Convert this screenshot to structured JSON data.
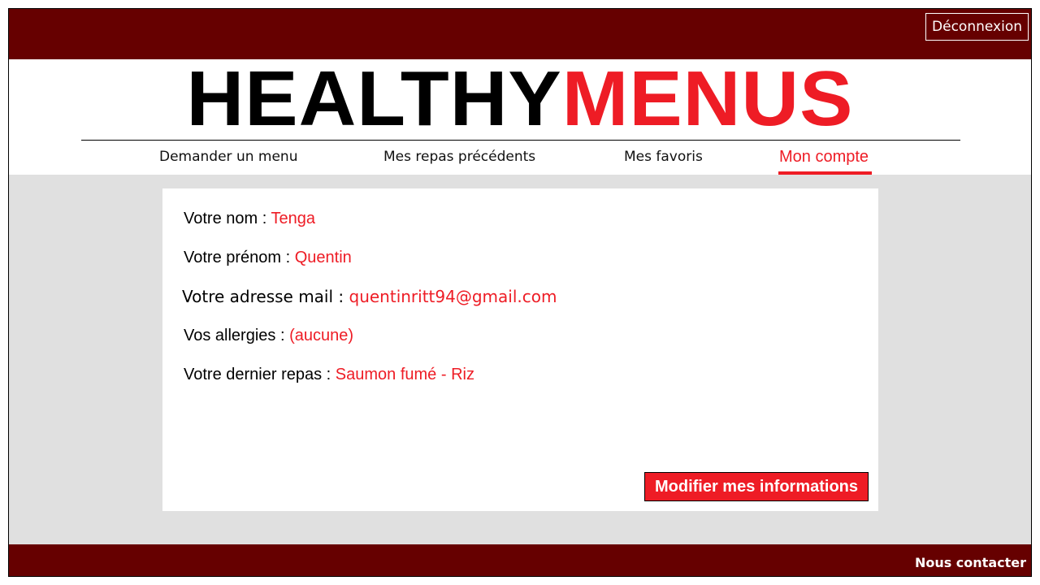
{
  "header": {
    "logout_label": "Déconnexion",
    "logo_part1": "HEALTHY",
    "logo_part2": "MENUS"
  },
  "nav": {
    "items": [
      {
        "label": "Demander un menu"
      },
      {
        "label": "Mes repas précédents"
      },
      {
        "label": "Mes favoris"
      },
      {
        "label": "Mon compte",
        "active": true
      }
    ]
  },
  "account": {
    "nom_label": "Votre nom : ",
    "nom_value": "Tenga",
    "prenom_label": "Votre prénom : ",
    "prenom_value": "Quentin",
    "mail_label": "Votre adresse mail : ",
    "mail_value": "quentinritt94@gmail.com",
    "allergies_label": "Vos allergies : ",
    "allergies_value": "(aucune)",
    "dernier_repas_label": "Votre dernier repas : ",
    "dernier_repas_value": "Saumon fumé - Riz",
    "modify_button": "Modifier mes informations"
  },
  "footer": {
    "contact_label": "Nous contacter"
  },
  "colors": {
    "brand_dark": "#660000",
    "accent_red": "#ee1c25",
    "content_bg": "#e0e0e0"
  }
}
